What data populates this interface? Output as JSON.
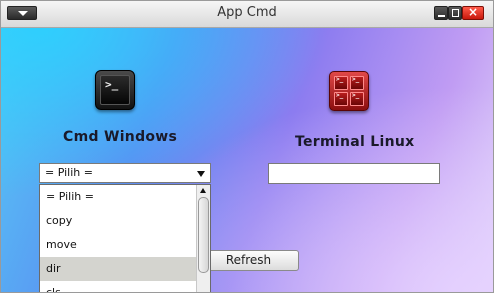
{
  "window": {
    "title": "App Cmd"
  },
  "left_panel": {
    "label": "Cmd Windows",
    "icon": "cmd-terminal-icon",
    "icon_glyph": ">_",
    "combo": {
      "selected": "= Pilih ="
    }
  },
  "right_panel": {
    "label": "Terminal Linux",
    "icon": "linux-terminal-icon",
    "icon_glyph": ">_",
    "input": {
      "value": "",
      "placeholder": ""
    }
  },
  "dropdown": {
    "items": [
      {
        "label": "= Pilih ="
      },
      {
        "label": "copy"
      },
      {
        "label": "move"
      },
      {
        "label": "dir"
      },
      {
        "label": "cls"
      }
    ],
    "highlighted": "dir"
  },
  "buttons": {
    "refresh": "Refresh"
  },
  "colors": {
    "close": "#d9231a",
    "terminal_icon": "#b81d1d",
    "cmd_icon": "#1a1a1a",
    "background_start": "#55c8f5",
    "background_end": "#e2d6fb"
  }
}
